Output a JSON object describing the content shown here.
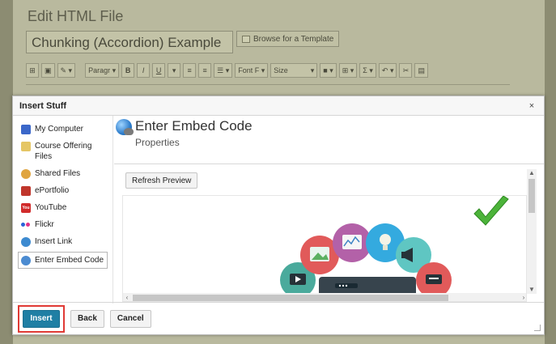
{
  "page": {
    "title": "Edit HTML File",
    "filename_value": "Chunking (Accordion) Example",
    "browse_template_label": "Browse for a Template",
    "toolbar": {
      "paragraph_label": "Paragr",
      "bold": "B",
      "italic": "I",
      "underline": "U",
      "font_family_label": "Font F",
      "size_label": "Size",
      "sigma": "Σ"
    }
  },
  "dialog": {
    "title": "Insert Stuff",
    "close_label": "×",
    "sidebar": {
      "items": [
        {
          "label": "My Computer",
          "icon": "computer-icon"
        },
        {
          "label": "Course Offering Files",
          "icon": "folder-icon"
        },
        {
          "label": "Shared Files",
          "icon": "shared-files-icon"
        },
        {
          "label": "ePortfolio",
          "icon": "eportfolio-icon"
        },
        {
          "label": "YouTube",
          "icon": "youtube-icon"
        },
        {
          "label": "Flickr",
          "icon": "flickr-icon"
        },
        {
          "label": "Insert Link",
          "icon": "link-icon"
        },
        {
          "label": "Enter Embed Code",
          "icon": "embed-icon",
          "selected": true
        }
      ]
    },
    "content": {
      "heading": "Enter Embed Code",
      "subheading": "Properties",
      "refresh_label": "Refresh Preview",
      "youtube_icon_text": "You"
    },
    "footer": {
      "insert_label": "Insert",
      "back_label": "Back",
      "cancel_label": "Cancel"
    }
  },
  "colors": {
    "primary_button": "#1f7fa4",
    "highlight_border": "#e03a35",
    "checkmark": "#4cb33a"
  }
}
